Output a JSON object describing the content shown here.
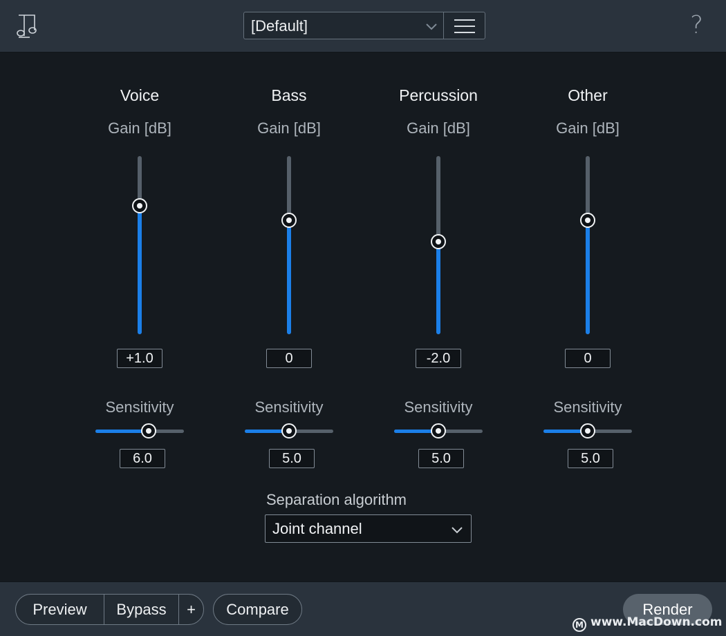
{
  "toolbar": {
    "preset_value": "[Default]",
    "help_label": "?"
  },
  "columns": [
    {
      "title": "Voice",
      "gain_label": "Gain [dB]",
      "gain_value": "+1.0",
      "gain_level": 0.72,
      "sensitivity_label": "Sensitivity",
      "sensitivity_value": "6.0",
      "sensitivity_level": 0.6
    },
    {
      "title": "Bass",
      "gain_label": "Gain [dB]",
      "gain_value": "0",
      "gain_level": 0.64,
      "sensitivity_label": "Sensitivity",
      "sensitivity_value": "5.0",
      "sensitivity_level": 0.5
    },
    {
      "title": "Percussion",
      "gain_label": "Gain [dB]",
      "gain_value": "-2.0",
      "gain_level": 0.52,
      "sensitivity_label": "Sensitivity",
      "sensitivity_value": "5.0",
      "sensitivity_level": 0.5
    },
    {
      "title": "Other",
      "gain_label": "Gain [dB]",
      "gain_value": "0",
      "gain_level": 0.64,
      "sensitivity_label": "Sensitivity",
      "sensitivity_value": "5.0",
      "sensitivity_level": 0.5
    }
  ],
  "algorithm": {
    "label": "Separation algorithm",
    "value": "Joint channel"
  },
  "footer": {
    "preview_label": "Preview",
    "bypass_label": "Bypass",
    "plus_label": "+",
    "compare_label": "Compare",
    "render_label": "Render",
    "watermark_text": "www.MacDown.com"
  },
  "colors": {
    "accent": "#1b7fe8",
    "panel": "#151a1f",
    "bar": "#2a333d"
  }
}
